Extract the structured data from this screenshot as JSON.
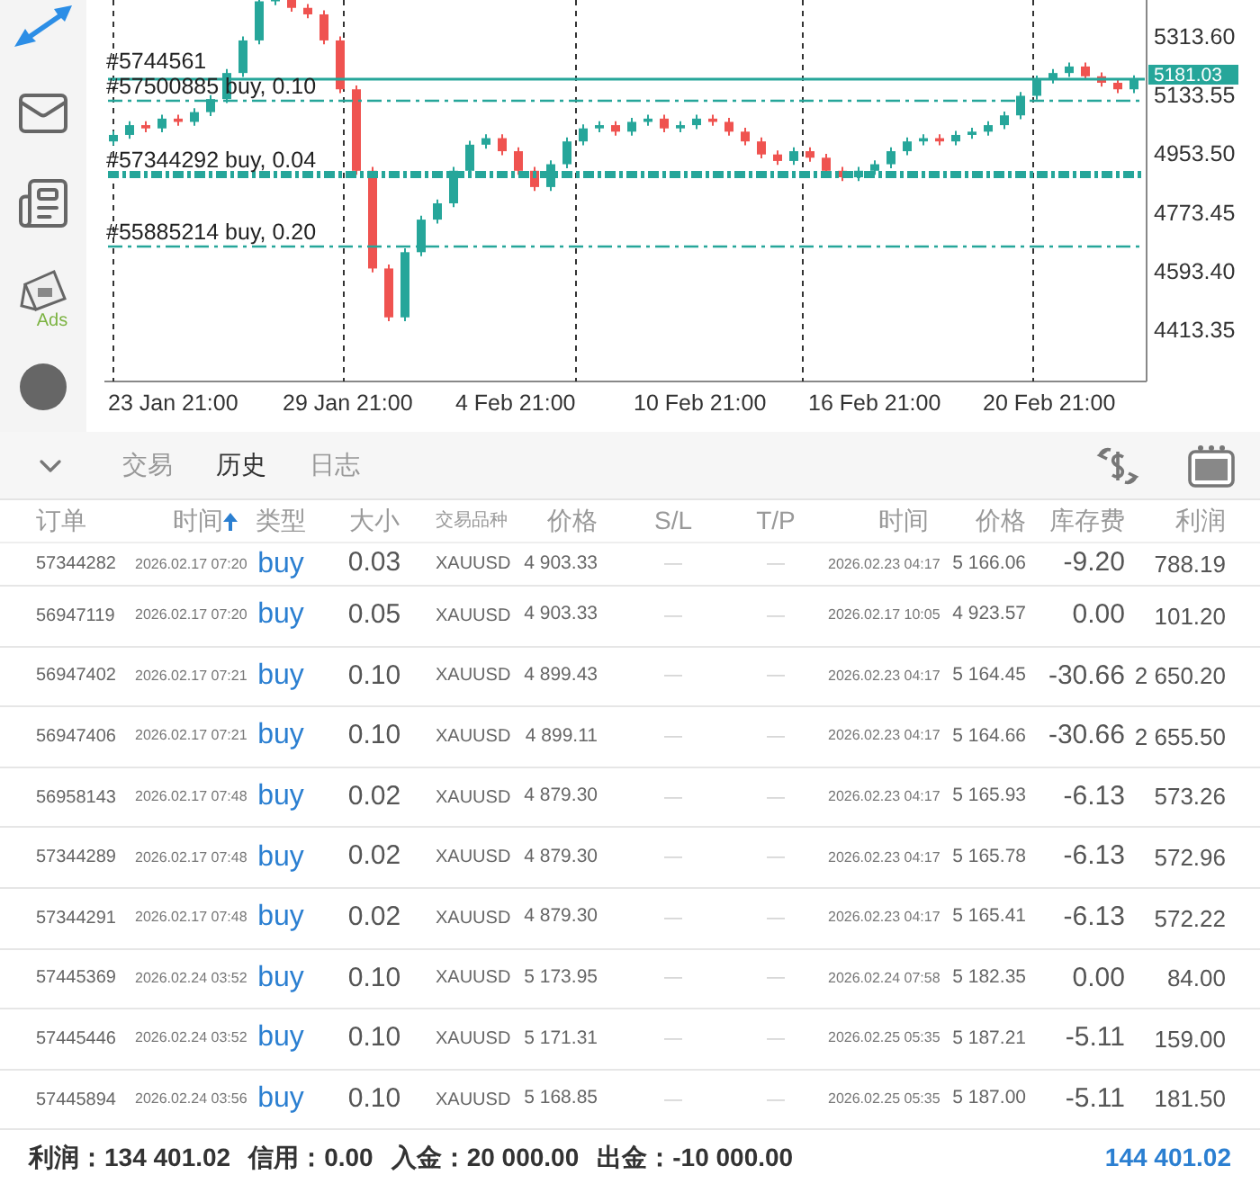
{
  "sidebar": {
    "ads_label": "Ads"
  },
  "chart": {
    "chart_data": {
      "type": "candlestick",
      "categories": [
        null,
        null,
        null,
        null,
        null,
        null,
        null,
        null,
        null,
        null,
        null,
        null,
        null,
        null,
        null,
        null,
        null,
        null,
        null,
        null,
        null,
        null,
        null,
        null,
        null,
        null,
        null,
        null,
        null,
        null,
        null,
        null,
        null,
        null,
        null,
        null,
        null,
        null,
        null,
        null,
        null,
        null,
        null,
        null,
        null,
        null,
        null,
        null,
        null,
        null,
        null,
        null,
        null,
        null,
        null,
        null,
        null,
        null,
        null,
        null,
        null,
        null,
        null,
        null
      ],
      "ohlc": [
        [
          4990,
          5022,
          4978,
          5010
        ],
        [
          5010,
          5052,
          4998,
          5040
        ],
        [
          5040,
          5052,
          5018,
          5030
        ],
        [
          5030,
          5072,
          5018,
          5060
        ],
        [
          5060,
          5072,
          5038,
          5050
        ],
        [
          5050,
          5092,
          5038,
          5080
        ],
        [
          5080,
          5132,
          5068,
          5120
        ],
        [
          5120,
          5212,
          5108,
          5200
        ],
        [
          5200,
          5312,
          5188,
          5300
        ],
        [
          5300,
          5432,
          5288,
          5420
        ],
        [
          5420,
          5462,
          5408,
          5450
        ],
        [
          5450,
          5462,
          5388,
          5400
        ],
        [
          5400,
          5412,
          5368,
          5380
        ],
        [
          5380,
          5392,
          5288,
          5300
        ],
        [
          5300,
          5312,
          5138,
          5150
        ],
        [
          5150,
          5162,
          4888,
          4900
        ],
        [
          4900,
          4912,
          4588,
          4600
        ],
        [
          4600,
          4612,
          4438,
          4450
        ],
        [
          4450,
          4662,
          4438,
          4650
        ],
        [
          4650,
          4762,
          4638,
          4750
        ],
        [
          4750,
          4812,
          4738,
          4800
        ],
        [
          4800,
          4912,
          4788,
          4900
        ],
        [
          4900,
          4992,
          4888,
          4980
        ],
        [
          4980,
          5012,
          4968,
          5000
        ],
        [
          5000,
          5012,
          4948,
          4960
        ],
        [
          4960,
          4972,
          4888,
          4900
        ],
        [
          4900,
          4912,
          4838,
          4850
        ],
        [
          4850,
          4932,
          4838,
          4920
        ],
        [
          4920,
          5002,
          4908,
          4990
        ],
        [
          4990,
          5042,
          4978,
          5030
        ],
        [
          5030,
          5052,
          5018,
          5040
        ],
        [
          5040,
          5052,
          5008,
          5020
        ],
        [
          5020,
          5062,
          5008,
          5050
        ],
        [
          5050,
          5072,
          5038,
          5060
        ],
        [
          5060,
          5072,
          5018,
          5030
        ],
        [
          5030,
          5052,
          5018,
          5040
        ],
        [
          5040,
          5072,
          5028,
          5060
        ],
        [
          5060,
          5072,
          5038,
          5050
        ],
        [
          5050,
          5062,
          5008,
          5020
        ],
        [
          5020,
          5032,
          4978,
          4990
        ],
        [
          4990,
          5002,
          4938,
          4950
        ],
        [
          4950,
          4962,
          4918,
          4930
        ],
        [
          4930,
          4972,
          4918,
          4960
        ],
        [
          4960,
          4972,
          4928,
          4940
        ],
        [
          4940,
          4952,
          4888,
          4900
        ],
        [
          4900,
          4912,
          4868,
          4880
        ],
        [
          4880,
          4912,
          4868,
          4900
        ],
        [
          4900,
          4932,
          4888,
          4920
        ],
        [
          4920,
          4972,
          4908,
          4960
        ],
        [
          4960,
          5002,
          4948,
          4990
        ],
        [
          4990,
          5012,
          4978,
          5000
        ],
        [
          5000,
          5012,
          4978,
          4990
        ],
        [
          4990,
          5022,
          4978,
          5010
        ],
        [
          5010,
          5032,
          4998,
          5020
        ],
        [
          5020,
          5052,
          5008,
          5040
        ],
        [
          5040,
          5082,
          5028,
          5070
        ],
        [
          5070,
          5142,
          5058,
          5130
        ],
        [
          5130,
          5192,
          5118,
          5180
        ],
        [
          5180,
          5212,
          5168,
          5200
        ],
        [
          5200,
          5232,
          5188,
          5220
        ],
        [
          5220,
          5232,
          5178,
          5190
        ],
        [
          5190,
          5202,
          5158,
          5170
        ],
        [
          5170,
          5182,
          5138,
          5150
        ],
        [
          5150,
          5193,
          5138,
          5181
        ]
      ],
      "ylim": [
        4253.2,
        5424.1
      ],
      "yticks": [
        {
          "value": 5313.6,
          "label": "5313.60"
        },
        {
          "value": 5133.55,
          "label": "5133.55"
        },
        {
          "value": 4953.5,
          "label": "4953.50"
        },
        {
          "value": 4773.45,
          "label": "4773.45"
        },
        {
          "value": 4593.4,
          "label": "4593.40"
        },
        {
          "value": 4413.35,
          "label": "4413.35"
        }
      ]
    },
    "time_labels": [
      "23 Jan 21:00",
      "29 Jan 21:00",
      "4 Feb 21:00",
      "10 Feb 21:00",
      "16 Feb 21:00",
      "20 Feb 21:00"
    ],
    "orders": [
      {
        "label": "#5744561",
        "kind": "solid"
      },
      {
        "label": "#57500885 buy, 0.10",
        "kind": "dashdot"
      },
      {
        "label": "#57344292 buy, 0.04",
        "kind": "thick"
      },
      {
        "label": "#55885214 buy, 0.20",
        "kind": "dashdot"
      }
    ],
    "current_price": "5181.03"
  },
  "tabs": [
    {
      "label": "交易",
      "selected": false
    },
    {
      "label": "历史",
      "selected": true
    },
    {
      "label": "日志",
      "selected": false
    }
  ],
  "table": {
    "columns": [
      {
        "label": "订单",
        "sorted": false
      },
      {
        "label": "时间",
        "sorted": true
      },
      {
        "label": "类型",
        "sorted": false
      },
      {
        "label": "大小",
        "sorted": false
      },
      {
        "label": "交易品种",
        "sorted": false
      },
      {
        "label": "价格",
        "sorted": false
      },
      {
        "label": "S/L",
        "sorted": false
      },
      {
        "label": "T/P",
        "sorted": false
      },
      {
        "label": "时间",
        "sorted": false
      },
      {
        "label": "价格",
        "sorted": false
      },
      {
        "label": "库存费",
        "sorted": false
      },
      {
        "label": "利润",
        "sorted": false
      }
    ],
    "rows": [
      {
        "order": "57344282",
        "open_time": "2026.02.17 07:20",
        "type": "buy",
        "size": "0.03",
        "symbol": "XAUUSD",
        "open_price": "4 903.33",
        "sl": "—",
        "tp": "—",
        "close_time": "2026.02.23 04:17",
        "close_price": "5 166.06",
        "swap": "-9.20",
        "profit": "788.19"
      },
      {
        "order": "56947119",
        "open_time": "2026.02.17 07:20",
        "type": "buy",
        "size": "0.05",
        "symbol": "XAUUSD",
        "open_price": "4 903.33",
        "sl": "—",
        "tp": "—",
        "close_time": "2026.02.17 10:05",
        "close_price": "4 923.57",
        "swap": "0.00",
        "profit": "101.20"
      },
      {
        "order": "56947402",
        "open_time": "2026.02.17 07:21",
        "type": "buy",
        "size": "0.10",
        "symbol": "XAUUSD",
        "open_price": "4 899.43",
        "sl": "—",
        "tp": "—",
        "close_time": "2026.02.23 04:17",
        "close_price": "5 164.45",
        "swap": "-30.66",
        "profit": "2 650.20"
      },
      {
        "order": "56947406",
        "open_time": "2026.02.17 07:21",
        "type": "buy",
        "size": "0.10",
        "symbol": "XAUUSD",
        "open_price": "4 899.11",
        "sl": "—",
        "tp": "—",
        "close_time": "2026.02.23 04:17",
        "close_price": "5 164.66",
        "swap": "-30.66",
        "profit": "2 655.50"
      },
      {
        "order": "56958143",
        "open_time": "2026.02.17 07:48",
        "type": "buy",
        "size": "0.02",
        "symbol": "XAUUSD",
        "open_price": "4 879.30",
        "sl": "—",
        "tp": "—",
        "close_time": "2026.02.23 04:17",
        "close_price": "5 165.93",
        "swap": "-6.13",
        "profit": "573.26"
      },
      {
        "order": "57344289",
        "open_time": "2026.02.17 07:48",
        "type": "buy",
        "size": "0.02",
        "symbol": "XAUUSD",
        "open_price": "4 879.30",
        "sl": "—",
        "tp": "—",
        "close_time": "2026.02.23 04:17",
        "close_price": "5 165.78",
        "swap": "-6.13",
        "profit": "572.96"
      },
      {
        "order": "57344291",
        "open_time": "2026.02.17 07:48",
        "type": "buy",
        "size": "0.02",
        "symbol": "XAUUSD",
        "open_price": "4 879.30",
        "sl": "—",
        "tp": "—",
        "close_time": "2026.02.23 04:17",
        "close_price": "5 165.41",
        "swap": "-6.13",
        "profit": "572.22"
      },
      {
        "order": "57445369",
        "open_time": "2026.02.24 03:52",
        "type": "buy",
        "size": "0.10",
        "symbol": "XAUUSD",
        "open_price": "5 173.95",
        "sl": "—",
        "tp": "—",
        "close_time": "2026.02.24 07:58",
        "close_price": "5 182.35",
        "swap": "0.00",
        "profit": "84.00"
      },
      {
        "order": "57445446",
        "open_time": "2026.02.24 03:52",
        "type": "buy",
        "size": "0.10",
        "symbol": "XAUUSD",
        "open_price": "5 171.31",
        "sl": "—",
        "tp": "—",
        "close_time": "2026.02.25 05:35",
        "close_price": "5 187.21",
        "swap": "-5.11",
        "profit": "159.00"
      },
      {
        "order": "57445894",
        "open_time": "2026.02.24 03:56",
        "type": "buy",
        "size": "0.10",
        "symbol": "XAUUSD",
        "open_price": "5 168.85",
        "sl": "—",
        "tp": "—",
        "close_time": "2026.02.25 05:35",
        "close_price": "5 187.00",
        "swap": "-5.11",
        "profit": "181.50"
      }
    ]
  },
  "footer": {
    "items": [
      {
        "label": "利润：",
        "value": "134 401.02"
      },
      {
        "label": "信用：",
        "value": "0.00"
      },
      {
        "label": "入金：",
        "value": "20 000.00"
      },
      {
        "label": "出金：",
        "value": "-10 000.00"
      }
    ],
    "total": "144 401.02"
  }
}
